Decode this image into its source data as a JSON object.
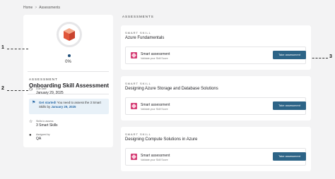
{
  "breadcrumb": {
    "home": "Home",
    "separator": ">",
    "current": "Assessments"
  },
  "summary": {
    "progress_label": "0%",
    "progress_value": 0,
    "eyebrow": "ASSESSMENT",
    "title": "Onboarding Skill Assessment",
    "due_label": "Due date",
    "due_value": "January 29, 2025",
    "notice_lead": "Get started!",
    "notice_body": " You need to assess the 3 Smart Skills by ",
    "notice_date": "January 29, 2025",
    "skills_label": "Skills to assess",
    "skills_value": "3 Smart Skills",
    "assigned_label": "Assigned by",
    "assigned_value": "QA"
  },
  "annotations": {
    "one": "1",
    "two": "2",
    "three": "3"
  },
  "section_title": "ASSESSMENTS",
  "skills": [
    {
      "eyebrow": "SMART SKILL",
      "title": "Azure Fundamentals",
      "item_title": "Smart assessment",
      "item_sub": "Validate your Skill Score",
      "button": "Take assessment"
    },
    {
      "eyebrow": "SMART SKILL",
      "title": "Designing Azure Storage and Database Solutions",
      "item_title": "Smart assessment",
      "item_sub": "Validate your Skill Score",
      "button": "Take assessment"
    },
    {
      "eyebrow": "SMART SKILL",
      "title": "Designing Compute Solutions in Azure",
      "item_title": "Smart assessment",
      "item_sub": "Validate your Skill Score",
      "button": "Take assessment"
    }
  ],
  "icons": {
    "calendar": "calendar-icon",
    "flag": "flag-icon",
    "star": "star-icon",
    "user": "user-icon",
    "skill": "skill-logo-icon"
  },
  "colors": {
    "button": "#2d6487",
    "notice_bg": "#e8f1f8",
    "accent": "#2a6aa6",
    "skill_logo": "#d43f76"
  }
}
